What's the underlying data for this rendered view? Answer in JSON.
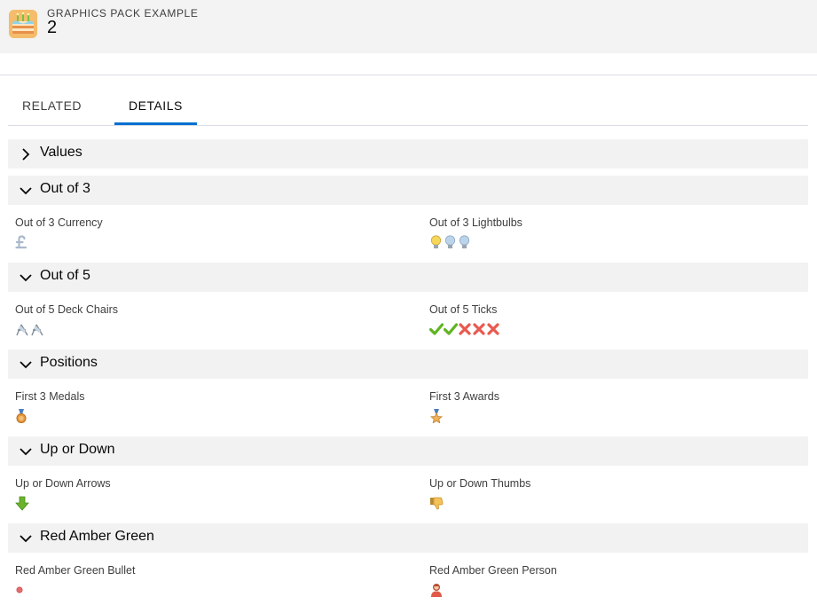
{
  "header": {
    "object_type": "GRAPHICS PACK EXAMPLE",
    "record_name": "2",
    "icon": "cake-icon"
  },
  "tabs": [
    {
      "label": "RELATED",
      "active": false
    },
    {
      "label": "DETAILS",
      "active": true
    }
  ],
  "sections": [
    {
      "title": "Values",
      "expanded": false,
      "fields": []
    },
    {
      "title": "Out of 3",
      "expanded": true,
      "fields": [
        {
          "label": "Out of 3 Currency",
          "icon": "pound-currency-icon",
          "rating": 1,
          "max": 3
        },
        {
          "label": "Out of 3 Lightbulbs",
          "icon": "lightbulb-icon",
          "rating": 1,
          "max": 3
        }
      ]
    },
    {
      "title": "Out of 5",
      "expanded": true,
      "fields": [
        {
          "label": "Out of 5 Deck Chairs",
          "icon": "deck-chair-icon",
          "rating": 2,
          "max": 5
        },
        {
          "label": "Out of 5 Ticks",
          "icon": "tick-cross-icon",
          "rating": 2,
          "max": 5
        }
      ]
    },
    {
      "title": "Positions",
      "expanded": true,
      "fields": [
        {
          "label": "First 3 Medals",
          "icon": "bronze-medal-icon",
          "value": "third"
        },
        {
          "label": "First 3 Awards",
          "icon": "bronze-award-star-icon",
          "value": "third"
        }
      ]
    },
    {
      "title": "Up or Down",
      "expanded": true,
      "fields": [
        {
          "label": "Up or Down Arrows",
          "icon": "down-arrow-icon",
          "value": "down"
        },
        {
          "label": "Up or Down Thumbs",
          "icon": "thumbs-down-icon",
          "value": "down"
        }
      ]
    },
    {
      "title": "Red Amber Green",
      "expanded": true,
      "fields": [
        {
          "label": "Red Amber Green Bullet",
          "icon": "red-bullet-icon",
          "value": "red"
        },
        {
          "label": "Red Amber Green Person",
          "icon": "red-person-icon",
          "value": "red"
        }
      ]
    }
  ],
  "colors": {
    "accent": "#0070d2",
    "section_bg": "#f3f2f2",
    "header_bg": "#f3f3f3",
    "tick_green": "#5fb520",
    "cross_red": "#e85a4f",
    "bullet_red": "#e86a6a"
  }
}
